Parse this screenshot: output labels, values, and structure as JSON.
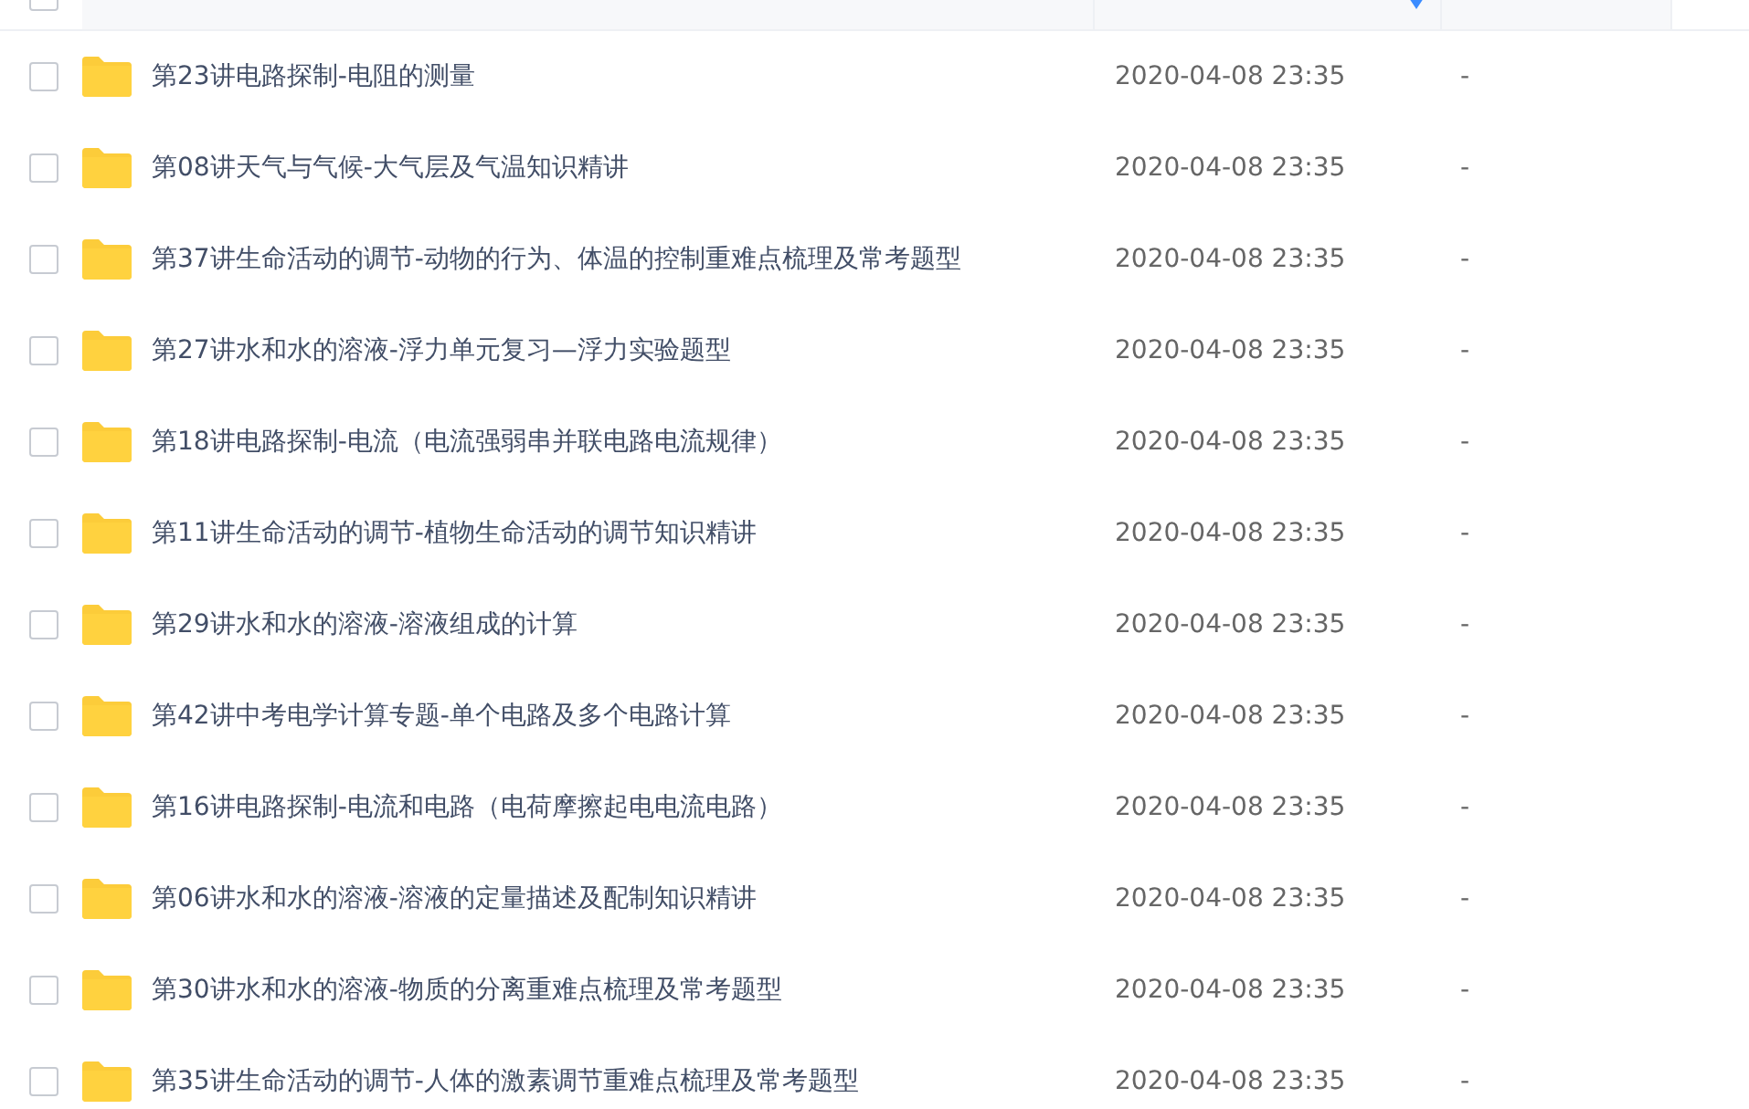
{
  "table": {
    "select_all_checked": false,
    "columns": [
      {
        "sorted": false
      },
      {
        "sorted": true
      },
      {
        "sorted": false
      }
    ],
    "rows": [
      {
        "name": "第23讲电路探制-电阻的测量",
        "modified": "2020-04-08 23:35",
        "size": "-",
        "checked": false
      },
      {
        "name": "第08讲天气与气候-大气层及气温知识精讲",
        "modified": "2020-04-08 23:35",
        "size": "-",
        "checked": false
      },
      {
        "name": "第37讲生命活动的调节-动物的行为、体温的控制重难点梳理及常考题型",
        "modified": "2020-04-08 23:35",
        "size": "-",
        "checked": false
      },
      {
        "name": "第27讲水和水的溶液-浮力单元复习—浮力实验题型",
        "modified": "2020-04-08 23:35",
        "size": "-",
        "checked": false
      },
      {
        "name": "第18讲电路探制-电流（电流强弱串并联电路电流规律）",
        "modified": "2020-04-08 23:35",
        "size": "-",
        "checked": false
      },
      {
        "name": "第11讲生命活动的调节-植物生命活动的调节知识精讲",
        "modified": "2020-04-08 23:35",
        "size": "-",
        "checked": false
      },
      {
        "name": "第29讲水和水的溶液-溶液组成的计算",
        "modified": "2020-04-08 23:35",
        "size": "-",
        "checked": false
      },
      {
        "name": "第42讲中考电学计算专题-单个电路及多个电路计算",
        "modified": "2020-04-08 23:35",
        "size": "-",
        "checked": false
      },
      {
        "name": "第16讲电路探制-电流和电路（电荷摩擦起电电流电路）",
        "modified": "2020-04-08 23:35",
        "size": "-",
        "checked": false
      },
      {
        "name": "第06讲水和水的溶液-溶液的定量描述及配制知识精讲",
        "modified": "2020-04-08 23:35",
        "size": "-",
        "checked": false
      },
      {
        "name": "第30讲水和水的溶液-物质的分离重难点梳理及常考题型",
        "modified": "2020-04-08 23:35",
        "size": "-",
        "checked": false
      },
      {
        "name": "第35讲生命活动的调节-人体的激素调节重难点梳理及常考题型",
        "modified": "2020-04-08 23:35",
        "size": "-",
        "checked": false
      }
    ]
  }
}
